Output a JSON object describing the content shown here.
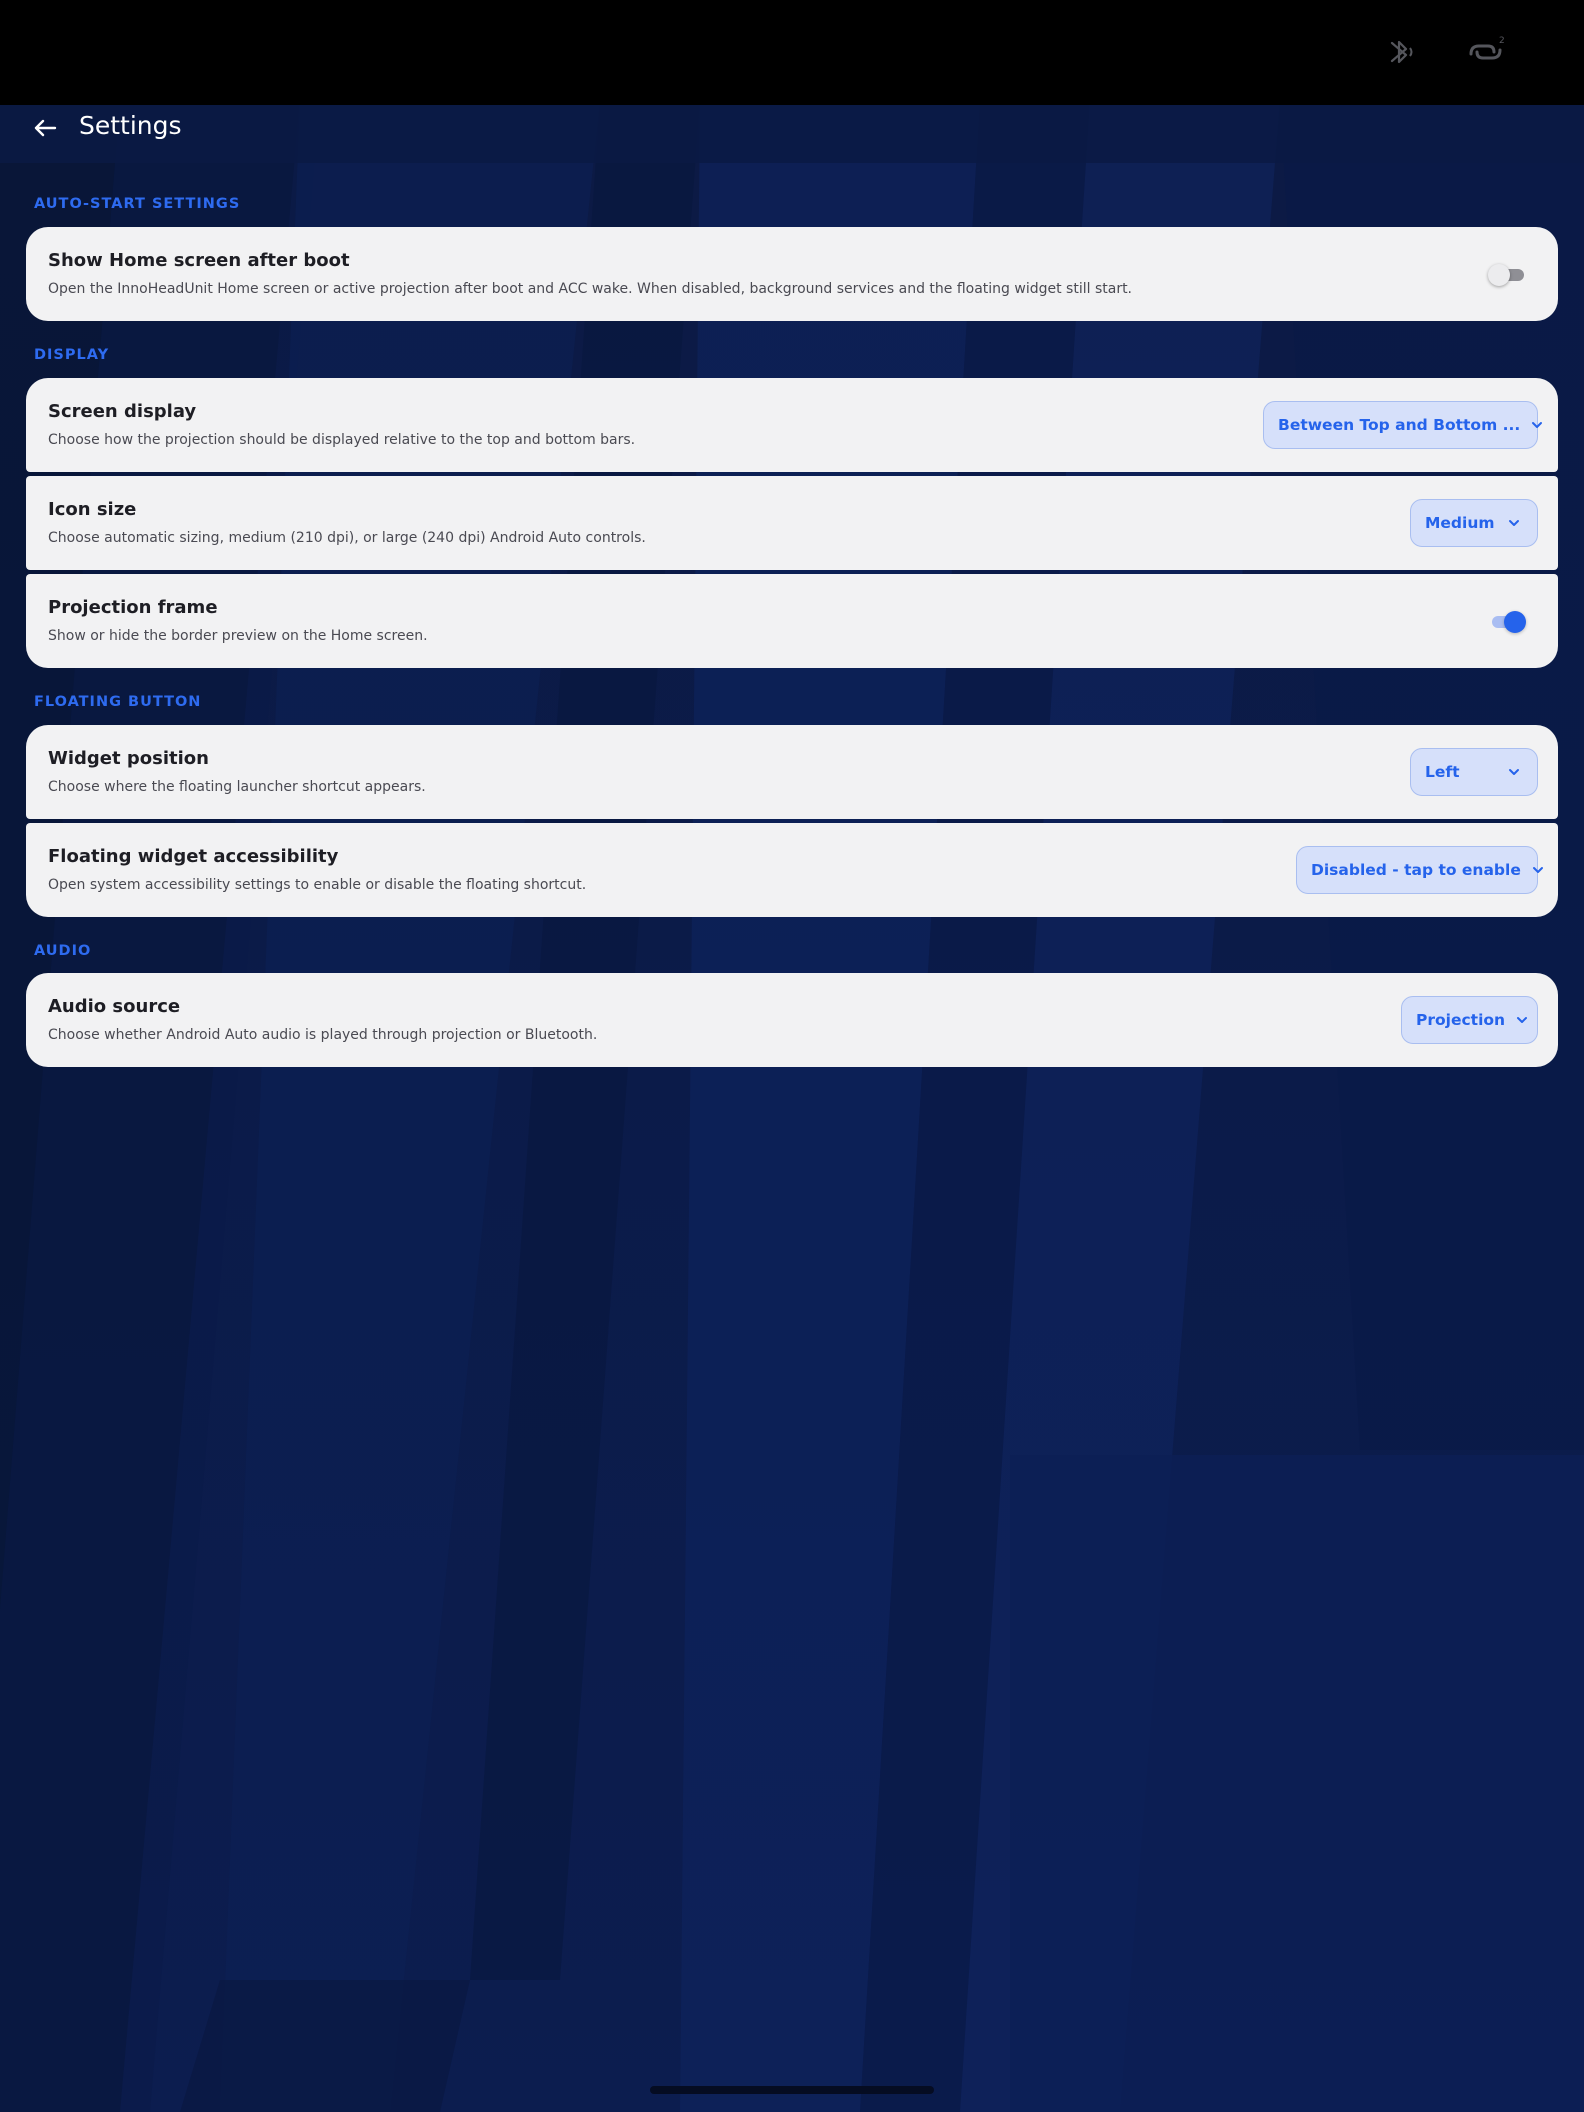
{
  "status_bar": {
    "bluetooth_icon": "bluetooth-icon",
    "link_icon": "link-icon",
    "link_badge": "2"
  },
  "app_bar": {
    "back_icon": "arrow-left-icon",
    "title": "Settings"
  },
  "sections": {
    "auto_start": {
      "header": "AUTO-START SETTINGS",
      "show_home": {
        "title": "Show Home screen after boot",
        "description": "Open the InnoHeadUnit Home screen or active projection after boot and ACC wake. When disabled, background services and the floating widget still start.",
        "enabled": false
      }
    },
    "display": {
      "header": "DISPLAY",
      "screen_display": {
        "title": "Screen display",
        "description": "Choose how the projection should be displayed relative to the top and bottom bars.",
        "value": "Between Top and Bottom ..."
      },
      "icon_size": {
        "title": "Icon size",
        "description": "Choose automatic sizing, medium (210 dpi), or large (240 dpi) Android Auto controls.",
        "value": "Medium"
      },
      "projection_frame": {
        "title": "Projection frame",
        "description": "Show or hide the border preview on the Home screen.",
        "enabled": true
      }
    },
    "floating_button": {
      "header": "FLOATING BUTTON",
      "widget_position": {
        "title": "Widget position",
        "description": "Choose where the floating launcher shortcut appears.",
        "value": "Left"
      },
      "accessibility": {
        "title": "Floating widget accessibility",
        "description": "Open system accessibility settings to enable or disable the floating shortcut.",
        "value": "Disabled - tap to enable"
      }
    },
    "audio": {
      "header": "AUDIO",
      "audio_source": {
        "title": "Audio source",
        "description": "Choose whether Android Auto audio is played through projection or Bluetooth.",
        "value": "Projection"
      }
    }
  },
  "colors": {
    "accent": "#2563eb",
    "section_header": "#2e6bf0",
    "card_background": "#f2f2f3",
    "dropdown_background": "#d6e0fa",
    "status_bar": "#000000",
    "wallpaper": "#0b1a45"
  }
}
